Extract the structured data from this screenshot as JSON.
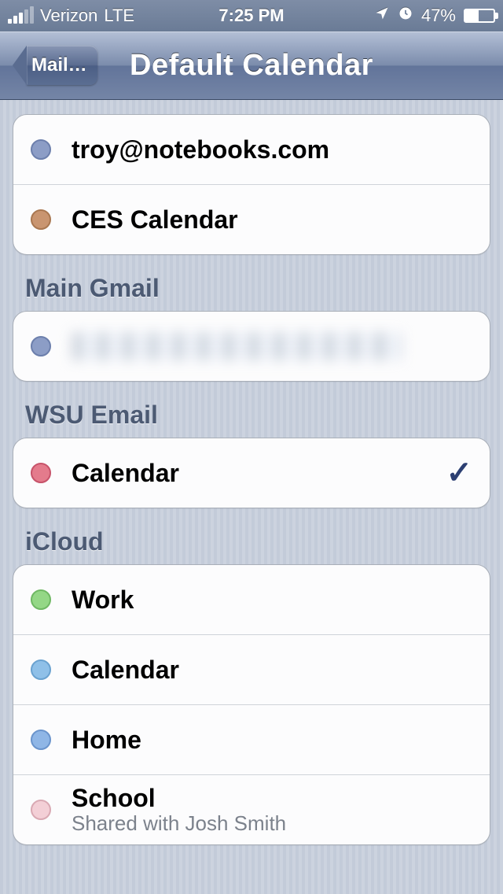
{
  "status": {
    "carrier": "Verizon",
    "network": "LTE",
    "time": "7:25 PM",
    "battery_pct": "47%",
    "battery_fill": 47,
    "signal_bars": 3
  },
  "nav": {
    "back_label": "Mail…",
    "title": "Default Calendar"
  },
  "groups": [
    {
      "header": null,
      "items": [
        {
          "label": "troy@notebooks.com",
          "color": "#8c9dc6",
          "border": "#6c7fac",
          "selected": false
        },
        {
          "label": "CES Calendar",
          "color": "#c99570",
          "border": "#a97750",
          "selected": false
        }
      ]
    },
    {
      "header": "Main Gmail",
      "items": [
        {
          "label": "",
          "redacted": true,
          "color": "#8c9dc6",
          "border": "#6c7fac",
          "selected": false
        }
      ]
    },
    {
      "header": "WSU Email",
      "items": [
        {
          "label": "Calendar",
          "color": "#e47b8c",
          "border": "#c7536a",
          "selected": true
        }
      ]
    },
    {
      "header": "iCloud",
      "items": [
        {
          "label": "Work",
          "color": "#94d786",
          "border": "#6fb863",
          "selected": false
        },
        {
          "label": "Calendar",
          "color": "#8fc0e8",
          "border": "#6aa2d0",
          "selected": false
        },
        {
          "label": "Home",
          "color": "#8fb6e6",
          "border": "#6a94cc",
          "selected": false
        },
        {
          "label": "School",
          "color": "#f3cfd6",
          "border": "#d9a9b3",
          "selected": false,
          "subtitle": "Shared with Josh Smith"
        }
      ]
    }
  ]
}
